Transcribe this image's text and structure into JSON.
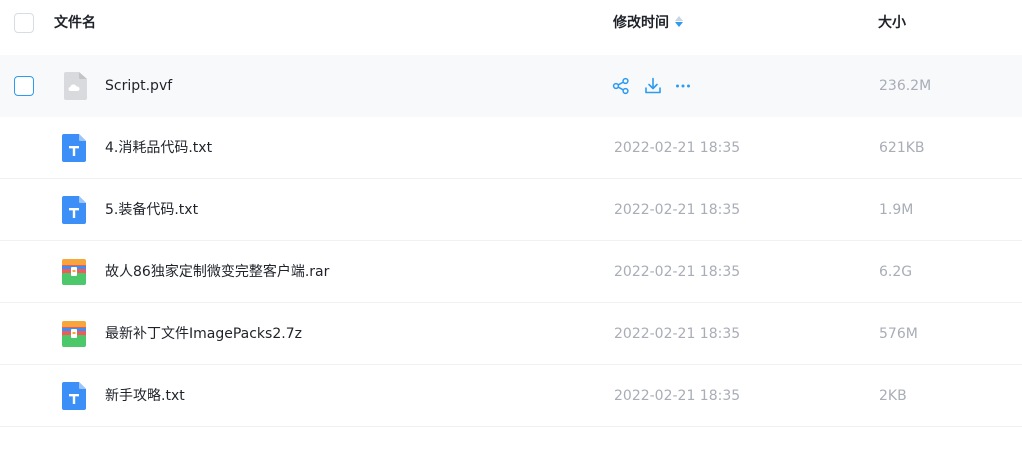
{
  "header": {
    "name_label": "文件名",
    "time_label": "修改时间",
    "size_label": "大小"
  },
  "files": [
    {
      "name": "Script.pvf",
      "time": "",
      "size": "236.2M",
      "icon": "cloud-file-icon",
      "hovered": true
    },
    {
      "name": "4.消耗品代码.txt",
      "time": "2022-02-21 18:35",
      "size": "621KB",
      "icon": "txt-file-icon"
    },
    {
      "name": "5.装备代码.txt",
      "time": "2022-02-21 18:35",
      "size": "1.9M",
      "icon": "txt-file-icon"
    },
    {
      "name": "故人86独家定制微变完整客户端.rar",
      "time": "2022-02-21 18:35",
      "size": "6.2G",
      "icon": "archive-file-icon"
    },
    {
      "name": "最新补丁文件ImagePacks2.7z",
      "time": "2022-02-21 18:35",
      "size": "576M",
      "icon": "archive-file-icon"
    },
    {
      "name": "新手攻略.txt",
      "time": "2022-02-21 18:35",
      "size": "2KB",
      "icon": "txt-file-icon"
    }
  ],
  "row_actions": [
    "share-icon",
    "download-icon",
    "more-icon"
  ],
  "colors": {
    "accent": "#2d9bf0",
    "txt_icon": "#3b8ff6",
    "muted_text": "#a8adb6",
    "hover_bg": "#f8f9fb"
  }
}
